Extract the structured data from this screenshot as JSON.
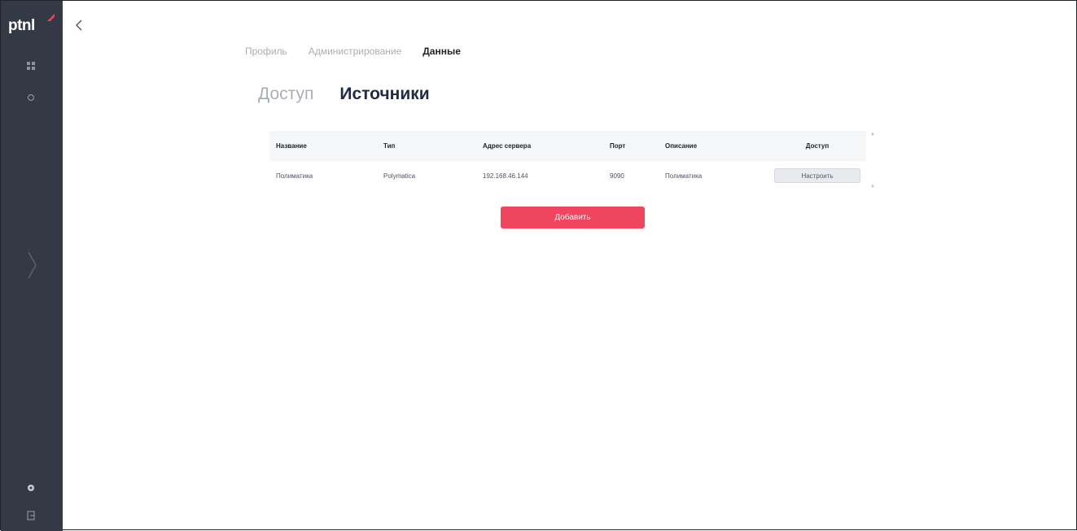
{
  "app": {
    "logo_text": "ptnl",
    "accent_color": "#f0455f",
    "sidebar_color": "#333945"
  },
  "sidebar": {
    "top_icons": [
      "grid-icon",
      "sun-icon"
    ],
    "bottom_icons": [
      "gear-icon",
      "logout-icon"
    ],
    "expand_icon": "chevron-right-icon"
  },
  "nav": {
    "back_icon": "chevron-left-icon"
  },
  "top_tabs": [
    {
      "label": "Профиль",
      "active": false
    },
    {
      "label": "Администрирование",
      "active": false
    },
    {
      "label": "Данные",
      "active": true
    }
  ],
  "sub_tabs": [
    {
      "label": "Доступ",
      "active": false
    },
    {
      "label": "Источники",
      "active": true
    }
  ],
  "table": {
    "headers": [
      "Название",
      "Тип",
      "Адрес сервера",
      "Порт",
      "Описание",
      "Доступ"
    ],
    "rows": [
      {
        "name": "Полиматика",
        "type": "Polymatica",
        "address": "192.168.46.144",
        "port": "9090",
        "description": "Полиматика",
        "action_label": "Настроить"
      }
    ]
  },
  "add_button": {
    "label": "Добавить"
  }
}
